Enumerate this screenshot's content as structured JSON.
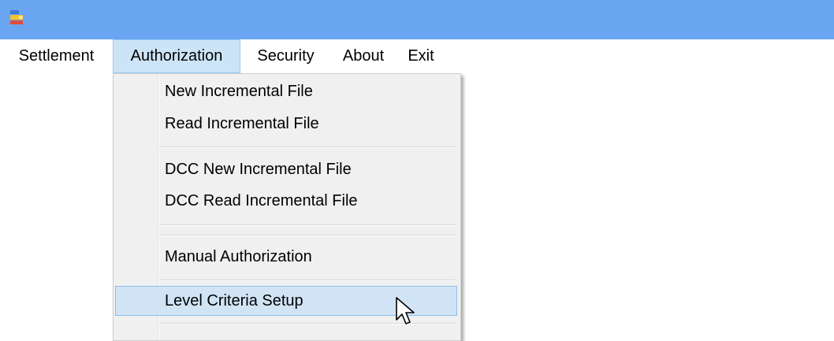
{
  "titlebar": {
    "color": "#6aa5f2",
    "icon": "app-icon"
  },
  "menubar": {
    "items": [
      "Settlement",
      "Authorization",
      "Security",
      "About",
      "Exit"
    ],
    "open_menu": "Authorization"
  },
  "authorization_menu": {
    "items": [
      "New Incremental File",
      "Read Incremental File",
      "DCC New Incremental File",
      "DCC Read Incremental File",
      "Manual Authorization",
      "Level Criteria Setup"
    ],
    "highlighted": "Level Criteria Setup"
  },
  "cursor": "arrow-cursor-icon"
}
